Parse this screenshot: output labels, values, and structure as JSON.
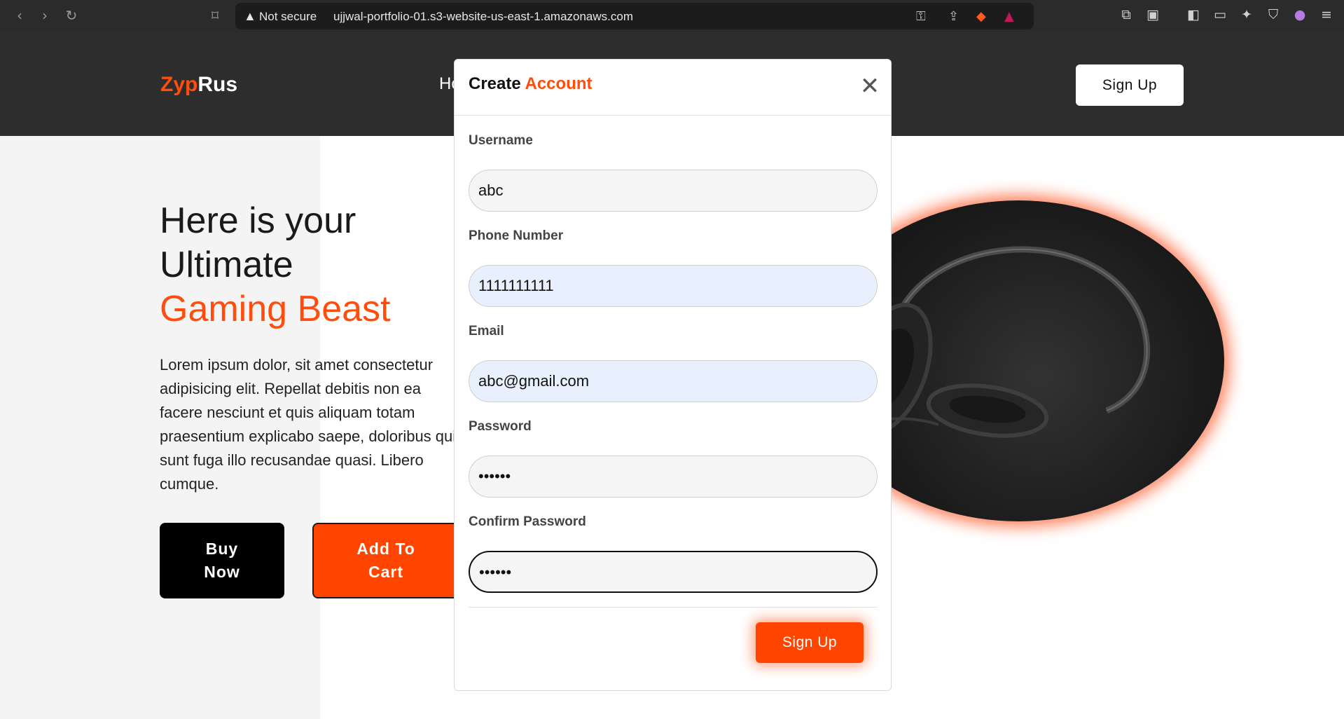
{
  "browser": {
    "security_label": "Not secure",
    "url": "ujjwal-portfolio-01.s3-website-us-east-1.amazonaws.com"
  },
  "header": {
    "logo_part1": "Zyp",
    "logo_part2": "Rus",
    "nav_partial": "Ho",
    "signup_label": "Sign Up"
  },
  "hero": {
    "title_line1": "Here is your",
    "title_line2": "Ultimate",
    "title_accent": "Gaming Beast",
    "description": "Lorem ipsum dolor, sit amet consectetur adipisicing elit. Repellat debitis non ea facere nesciunt et quis aliquam totam praesentium explicabo saepe, doloribus qui sunt fuga illo recusandae quasi. Libero cumque.",
    "buy_label_1": "Buy",
    "buy_label_2": "Now",
    "cart_label_1": "Add To",
    "cart_label_2": "Cart"
  },
  "modal": {
    "title_part1": "Create",
    "title_part2": "Account",
    "close_symbol": "✕",
    "fields": [
      {
        "label": "Username",
        "value": "abc"
      },
      {
        "label": "Phone Number",
        "value": "1111111111"
      },
      {
        "label": "Email",
        "value": "abc@gmail.com"
      },
      {
        "label": "Password",
        "value": "••••••"
      },
      {
        "label": "Confirm Password",
        "value": "••••••"
      }
    ],
    "submit_label": "Sign Up"
  },
  "colors": {
    "accent": "#ff4d0d",
    "header_bg": "#2d2d2d",
    "autofill_bg": "#e8f0fe"
  }
}
